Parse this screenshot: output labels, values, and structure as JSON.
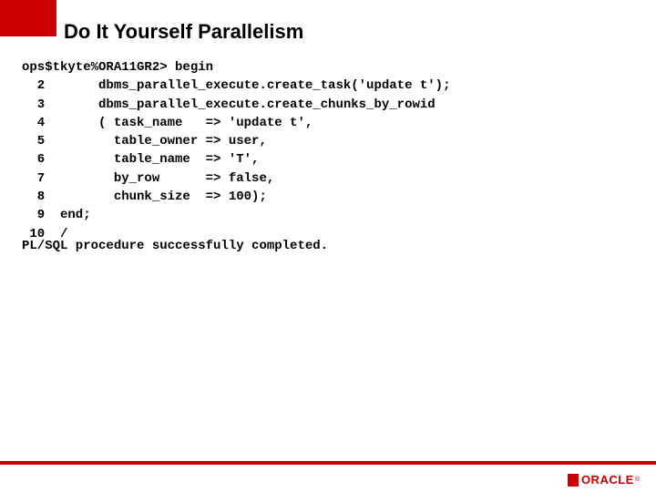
{
  "title": "Do It Yourself Parallelism",
  "code": {
    "prompt": "ops$tkyte%ORA11GR2>",
    "lines": [
      "ops$tkyte%ORA11GR2> begin",
      "  2       dbms_parallel_execute.create_task('update t');",
      "  3       dbms_parallel_execute.create_chunks_by_rowid",
      "  4       ( task_name   => 'update t',",
      "  5         table_owner => user,",
      "  6         table_name  => 'T',",
      "  7         by_row      => false,",
      "  8         chunk_size  => 100);",
      "  9  end;",
      " 10  /"
    ]
  },
  "result": "PL/SQL procedure successfully completed.",
  "logo": {
    "text": "ORACLE",
    "reg": "®"
  },
  "colors": {
    "brand": "#c00"
  }
}
